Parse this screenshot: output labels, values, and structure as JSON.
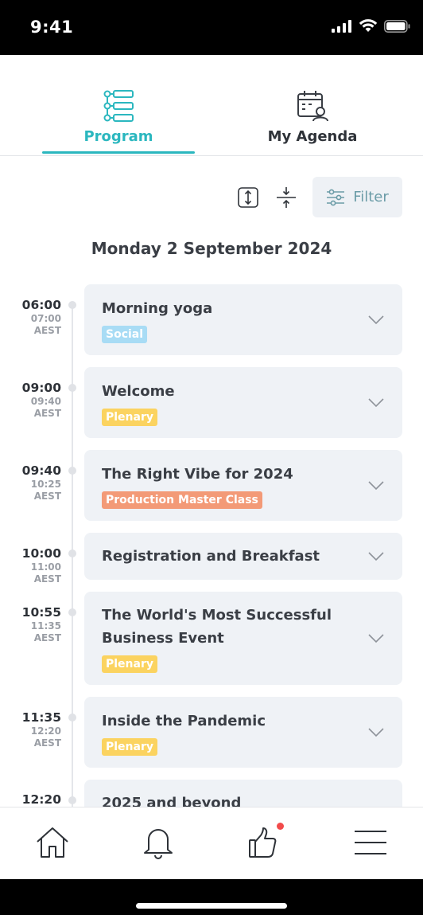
{
  "status_bar": {
    "time": "9:41"
  },
  "tabs": [
    {
      "label": "Program",
      "icon": "program-list-icon",
      "active": true
    },
    {
      "label": "My Agenda",
      "icon": "calendar-person-icon",
      "active": false
    }
  ],
  "toolbar": {
    "expand_icon": "expand-icon",
    "collapse_icon": "collapse-icon",
    "filter_label": "Filter"
  },
  "date_heading": "Monday 2 September 2024",
  "sessions": [
    {
      "time_local": "06:00",
      "time_alt": "07:00",
      "tz": "AEST",
      "title": "Morning yoga",
      "tag": "Social"
    },
    {
      "time_local": "09:00",
      "time_alt": "09:40",
      "tz": "AEST",
      "title": "Welcome",
      "tag": "Plenary"
    },
    {
      "time_local": "09:40",
      "time_alt": "10:25",
      "tz": "AEST",
      "title": "The Right Vibe for 2024",
      "tag": "Production Master Class"
    },
    {
      "time_local": "10:00",
      "time_alt": "11:00",
      "tz": "AEST",
      "title": "Registration and Breakfast",
      "tag": ""
    },
    {
      "time_local": "10:55",
      "time_alt": "11:35",
      "tz": "AEST",
      "title_line1": "The World's Most Successful",
      "title_line2": "Business Event",
      "tag": "Plenary"
    },
    {
      "time_local": "11:35",
      "time_alt": "12:20",
      "tz": "AEST",
      "title": "Inside the Pandemic",
      "tag": "Plenary"
    },
    {
      "time_local": "12:20",
      "title": "2025 and beyond"
    }
  ],
  "tag_colors": {
    "Social": "#a8dcf5",
    "Plenary": "#fbd360",
    "Production Master Class": "#f39a77"
  },
  "accent_color": "#2bb7bf",
  "bottom_nav": [
    {
      "name": "home-icon"
    },
    {
      "name": "bell-icon"
    },
    {
      "name": "thumbs-up-icon",
      "badge": true
    },
    {
      "name": "menu-icon"
    }
  ]
}
